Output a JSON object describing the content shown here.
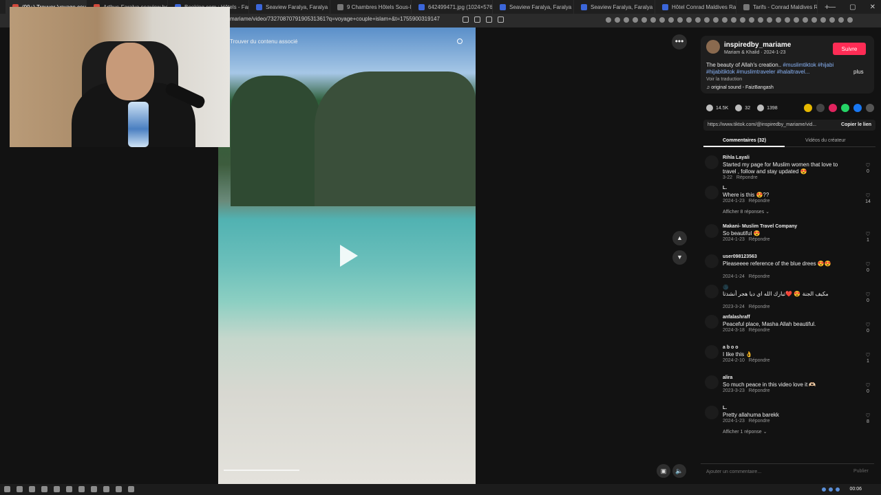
{
  "browser": {
    "tabs": [
      {
        "label": "(99+) Trouver 'voyage couple'",
        "active": true,
        "fav": "r"
      },
      {
        "label": "Arthus-Faralya seaview hotel resort",
        "active": false,
        "fav": "r"
      },
      {
        "label": "Booking.com : Hôtels - Faralya",
        "active": false,
        "fav": "b"
      },
      {
        "label": "Seaview Faralya, Faralya (tarifs act...",
        "active": false,
        "fav": "b"
      },
      {
        "label": "9 Chambres Hôtels Sous-Marins Pr...",
        "active": false,
        "fav": "g"
      },
      {
        "label": "642499471.jpg (1024×576)",
        "active": false,
        "fav": "b"
      },
      {
        "label": "Seaview Faralya, Faralya (tarifs act...",
        "active": false,
        "fav": "b"
      },
      {
        "label": "Seaview Faralya, Faralya (tarifs act...",
        "active": false,
        "fav": "b"
      },
      {
        "label": "Hôtel Conrad Maldives Rangali Isl...",
        "active": false,
        "fav": "b"
      },
      {
        "label": "Tarifs - Conrad Maldives Rangali Is...",
        "active": false,
        "fav": "g"
      }
    ],
    "new_tab": "+",
    "url": "mariame/video/7327087079190531361?q=voyage+couple+islam+&t=1755900319147"
  },
  "video": {
    "search_placeholder": "Trouver du contenu associé"
  },
  "post": {
    "username": "inspiredby_mariame",
    "subtitle": "Mariam & Khalid · 2024-1-23",
    "follow_label": "Suivre",
    "desc_text": "The beauty of Allah's creation..",
    "desc_tags_1": "#muslimtiktok #hijabi",
    "desc_tags_2": "#hijabitiktok #muslimtraveler #halaltravel...",
    "more_label": "plus",
    "translate_label": "Voir la traduction",
    "sound": "original sound - FaizBangash",
    "likes": "14.5K",
    "comments_count": "32",
    "saves": "1398",
    "link": "https://www.tiktok.com/@inspiredby_mariame/vid...",
    "copy_label": "Copier le lien",
    "tab_comments": "Commentaires (32)",
    "tab_creator": "Vidéos du créateur"
  },
  "comments": [
    {
      "user": "Rihla Layali",
      "text": "Started my page for Muslim women that love to travel , follow and stay updated 😍",
      "date": "3-22",
      "reply": "Répondre",
      "likes": "0",
      "replies": ""
    },
    {
      "user": "L.",
      "text": "Where is this 😍??",
      "date": "2024-1-23",
      "reply": "Répondre",
      "likes": "14",
      "replies": "Afficher 8 réponses ⌄"
    },
    {
      "user": "Makani- Muslim Travel Company",
      "text": "So beautiful 😍",
      "date": "2024-1-23",
      "reply": "Répondre",
      "likes": "1",
      "replies": ""
    },
    {
      "user": "user098123563",
      "text": "Pleaseeee reference of the blue drees 😍😍",
      "date": "2024-1-24",
      "reply": "Répondre",
      "likes": "0",
      "replies": ""
    },
    {
      "user": "🌑",
      "text": "مكيف الجنة 😍 ❤️تبارك الله اي ديا هجر أنشدتا",
      "date": "2023-3-24",
      "reply": "Répondre",
      "likes": "0",
      "replies": ""
    },
    {
      "user": "anfalashraff",
      "text": "Peaceful place, Masha Allah beautiful.",
      "date": "2024-3-18",
      "reply": "Répondre",
      "likes": "0",
      "replies": ""
    },
    {
      "user": "a b o o",
      "text": "I like this 👌",
      "date": "2024-2-10",
      "reply": "Répondre",
      "likes": "1",
      "replies": ""
    },
    {
      "user": "alira",
      "text": "So much peace in this video love it 🫶🏻",
      "date": "2023-3-23",
      "reply": "Répondre",
      "likes": "0",
      "replies": ""
    },
    {
      "user": "L.",
      "text": "Pretty allahuma barekk",
      "date": "2024-1-23",
      "reply": "Répondre",
      "likes": "8",
      "replies": "Afficher 1 réponse ⌄"
    }
  ],
  "comment_input": {
    "placeholder": "Ajouter un commentaire...",
    "publish_label": "Publier"
  },
  "taskbar": {
    "clock": "00:06"
  }
}
